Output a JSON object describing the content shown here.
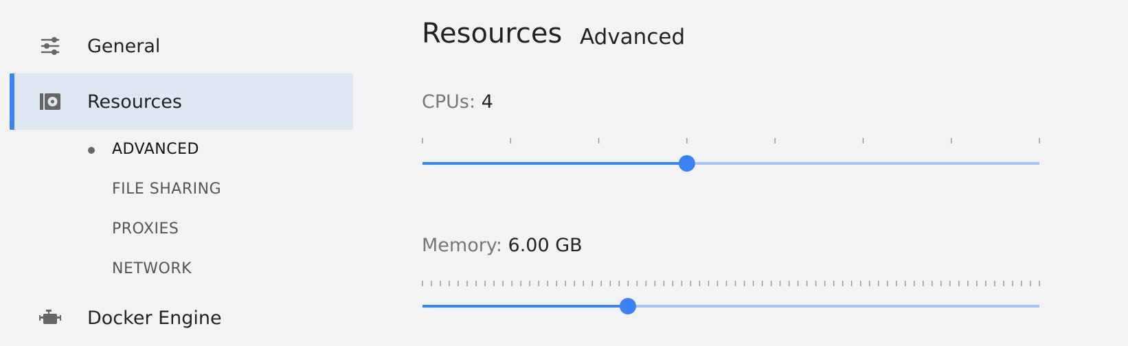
{
  "sidebar": {
    "items": [
      {
        "label": "General",
        "icon": "sliders-icon"
      },
      {
        "label": "Resources",
        "icon": "resources-icon",
        "active": true
      },
      {
        "label": "Docker Engine",
        "icon": "engine-icon"
      }
    ],
    "sub_items": [
      {
        "label": "ADVANCED",
        "active": true
      },
      {
        "label": "FILE SHARING"
      },
      {
        "label": "PROXIES"
      },
      {
        "label": "NETWORK"
      }
    ]
  },
  "header": {
    "title": "Resources",
    "subtitle": "Advanced"
  },
  "settings": {
    "cpus": {
      "label": "CPUs:",
      "value": "4",
      "fraction": 0.4286,
      "ticks": 8
    },
    "memory": {
      "label": "Memory:",
      "value": "6.00 GB",
      "fraction": 0.333,
      "ticks": 70
    }
  },
  "colors": {
    "accent": "#3b82f6",
    "track_inactive": "#a9c6f2",
    "active_bg": "#dde8f3"
  }
}
